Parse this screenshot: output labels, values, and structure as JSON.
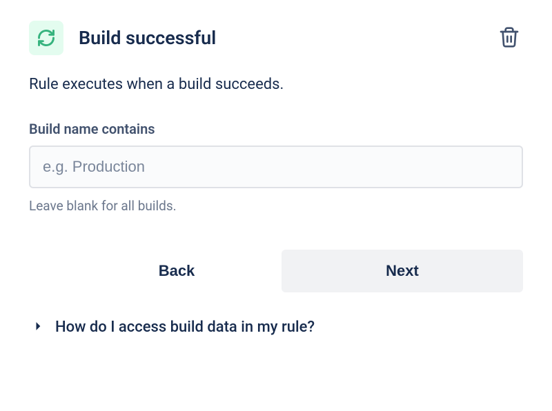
{
  "header": {
    "title": "Build successful",
    "icon": "refresh-icon"
  },
  "description": "Rule executes when a build succeeds.",
  "field": {
    "label": "Build name contains",
    "placeholder": "e.g. Production",
    "value": "",
    "helper": "Leave blank for all builds."
  },
  "buttons": {
    "back": "Back",
    "next": "Next"
  },
  "help": {
    "question": "How do I access build data in my rule?"
  }
}
